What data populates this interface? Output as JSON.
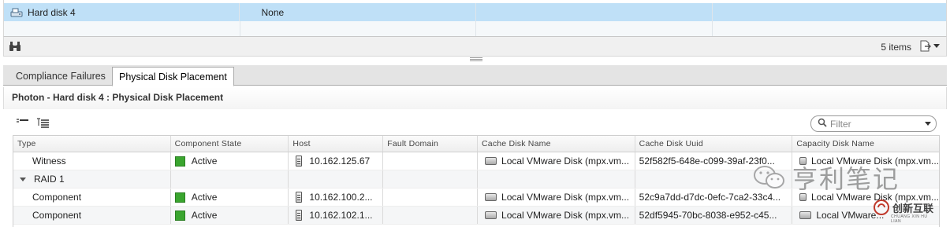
{
  "top_grid": {
    "rows": [
      {
        "name": "Hard disk 4",
        "value": "None",
        "selected": true
      }
    ]
  },
  "top_footer": {
    "items_count": "5 items"
  },
  "tabs": [
    {
      "label": "Compliance Failures",
      "active": false
    },
    {
      "label": "Physical Disk Placement",
      "active": true
    }
  ],
  "panel": {
    "title": "Photon - Hard disk 4 : Physical Disk Placement"
  },
  "filter": {
    "placeholder": "Filter"
  },
  "table": {
    "columns": [
      "Type",
      "Component State",
      "Host",
      "Fault Domain",
      "Cache Disk Name",
      "Cache Disk Uuid",
      "Capacity Disk Name"
    ],
    "rows": [
      {
        "type": "Witness",
        "state": "Active",
        "host": "10.162.125.67",
        "fault_domain": "",
        "cache_disk_name": "Local VMware Disk (mpx.vm...",
        "cache_disk_uuid": "52f582f5-648e-c099-39af-23f0...",
        "capacity_disk_name": "Local VMware Disk (mpx.vm..."
      },
      {
        "type": "RAID 1",
        "state": "",
        "host": "",
        "fault_domain": "",
        "cache_disk_name": "",
        "cache_disk_uuid": "",
        "capacity_disk_name": ""
      },
      {
        "type": "Component",
        "state": "Active",
        "host": "10.162.100.2...",
        "fault_domain": "",
        "cache_disk_name": "Local VMware Disk (mpx.vm...",
        "cache_disk_uuid": "52c9a7dd-d7dc-0efc-7ca2-33c4...",
        "capacity_disk_name": "Local VMware Disk (mpx.vm..."
      },
      {
        "type": "Component",
        "state": "Active",
        "host": "10.162.102.1...",
        "fault_domain": "",
        "cache_disk_name": "Local VMware Disk (mpx.vm...",
        "cache_disk_uuid": "52df5945-70bc-8038-e952-c45...",
        "capacity_disk_name": "Local VMware..."
      }
    ]
  },
  "colors": {
    "selected_row": "#bfe0f7",
    "active_status": "#3aa52f"
  },
  "watermarks": {
    "wm1": "亨利笔记",
    "wm2": "创新互联",
    "wm2_sub": "CHUANG XIN HU LIAN"
  }
}
